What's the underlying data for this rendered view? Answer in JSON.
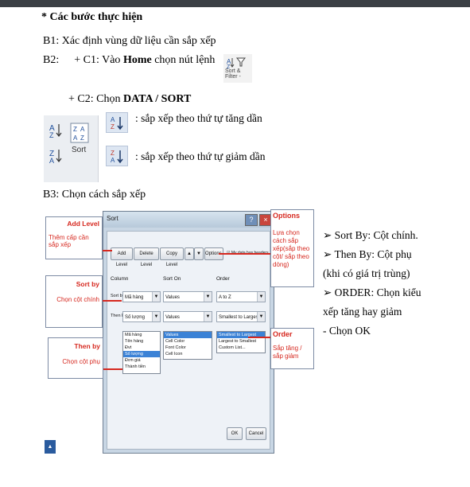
{
  "heading": "* Các bước thực hiện",
  "step1": "B1: Xác định vùng dữ liệu cần sắp xếp",
  "step2": {
    "label": "B2:",
    "c1_prefix": "+ C1: Vào ",
    "c1_bold": "Home",
    "c1_suffix": " chọn nút lệnh",
    "sort_filter_caption_1": "Sort &",
    "sort_filter_caption_2": "Filter -",
    "c2_prefix": "+ C2: Chọn ",
    "c2_bold": "DATA / SORT",
    "sort_label": "Sort",
    "asc_text": ": sắp xếp theo thứ tự tăng dần",
    "desc_text": ": sắp xếp theo thứ tự giảm dần"
  },
  "step3": "B3: Chọn  cách sắp xếp",
  "dialog": {
    "title": "Sort",
    "add_level": "Add Level",
    "delete_level": "Delete Level",
    "copy_level": "Copy Level",
    "options": "Options...",
    "my_data_headers": "My data has headers",
    "col_header": "Column",
    "sorton_header": "Sort On",
    "order_header": "Order",
    "sort_by": "Sort by",
    "then_by": "Then by",
    "row1": {
      "column": "Mã hàng",
      "sort_on": "Values",
      "order": "A to Z"
    },
    "row2": {
      "column": "Số lượng",
      "sort_on": "Values",
      "order": "Smallest to Largest"
    },
    "column_list": [
      "Mã hàng",
      "Tên hàng",
      "Đvt",
      "Số lượng",
      "Đơn giá",
      "Thành tiền"
    ],
    "sorton_list": [
      "Values",
      "Cell Color",
      "Font Color",
      "Cell Icon"
    ],
    "order_list": [
      "Smallest to Largest",
      "Largest to Smallest",
      "Custom List..."
    ],
    "ok": "OK",
    "cancel": "Cancel"
  },
  "callouts": {
    "add_level": {
      "head": "Add Level",
      "body": "Thêm cấp cần sắp xếp"
    },
    "sort_by": {
      "head": "Sort by",
      "body": "Chọn cột chính"
    },
    "then_by": {
      "head": "Then by",
      "body": "Chọn cột phụ"
    },
    "options": {
      "head": "Options",
      "body": "Lựa chọn cách sắp xếp(sắp theo cột/ sắp theo dòng)"
    },
    "order": {
      "head": "Order",
      "body": "Sắp tăng / sắp giảm"
    }
  },
  "bullets": [
    "➢ Sort By: Cột  chính.",
    "➢ Then By: Cột  phụ",
    "(khi có giá trị trùng)",
    "➢ ORDER: Chọn kiểu",
    "xếp tăng hay giảm",
    "- Chọn OK"
  ],
  "colors": {
    "accent_red": "#d6281f",
    "topbar": "#3b3f44"
  },
  "icons": [
    "sort-filter-icon",
    "sort-az-icon",
    "sort-za-icon",
    "sort-dialog-icon",
    "sort-ascending-icon",
    "sort-descending-icon",
    "logo-icon"
  ]
}
